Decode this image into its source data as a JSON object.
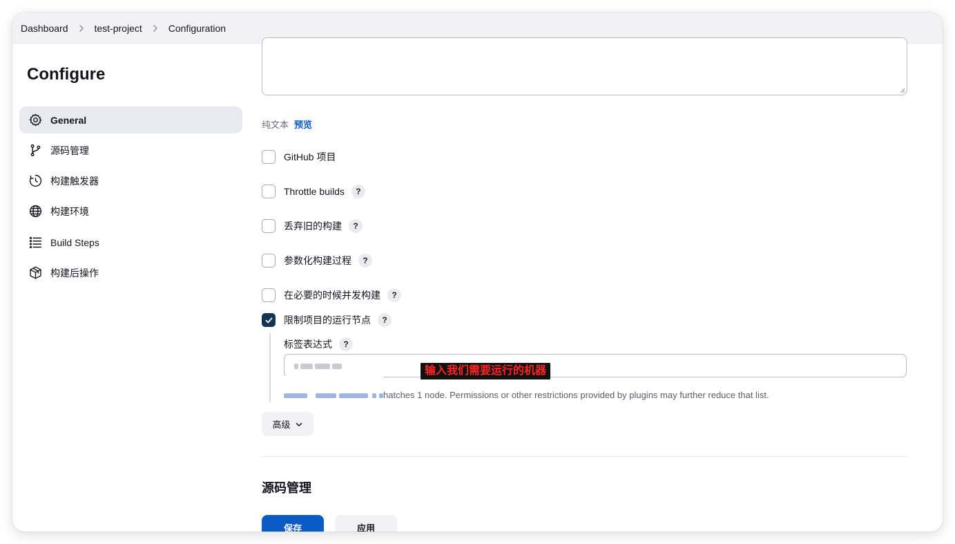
{
  "breadcrumb": {
    "items": [
      "Dashboard",
      "test-project",
      "Configuration"
    ]
  },
  "sidebar": {
    "title": "Configure",
    "items": [
      {
        "label": "General",
        "icon": "gear-icon",
        "active": true
      },
      {
        "label": "源码管理",
        "icon": "branch-icon"
      },
      {
        "label": "构建触发器",
        "icon": "timer-icon"
      },
      {
        "label": "构建环境",
        "icon": "globe-icon"
      },
      {
        "label": "Build Steps",
        "icon": "list-icon"
      },
      {
        "label": "构建后操作",
        "icon": "package-icon"
      }
    ]
  },
  "description": {
    "format_plain": "纯文本",
    "format_preview": "预览"
  },
  "options": [
    {
      "label": "GitHub 项目",
      "checked": false,
      "help": false
    },
    {
      "label": "Throttle builds",
      "checked": false,
      "help": true
    },
    {
      "label": "丢弃旧的构建",
      "checked": false,
      "help": true
    },
    {
      "label": "参数化构建过程",
      "checked": false,
      "help": true
    },
    {
      "label": "在必要的时候并发构建",
      "checked": false,
      "help": true
    },
    {
      "label": "限制项目的运行节点",
      "checked": true,
      "help": true
    }
  ],
  "help_symbol": "?",
  "label_expression": {
    "label": "标签表达式",
    "annotation": "输入我们需要运行的机器",
    "hint_suffix": "hatches 1 node. Permissions or other restrictions provided by plugins may further reduce that list."
  },
  "advanced_label": "高级",
  "next_section_title": "源码管理",
  "footer": {
    "save_label": "保存",
    "apply_label": "应用"
  },
  "colors": {
    "primary": "#0b5bc6",
    "checkbox_checked": "#14344f",
    "annotation_text": "#ff2424"
  }
}
